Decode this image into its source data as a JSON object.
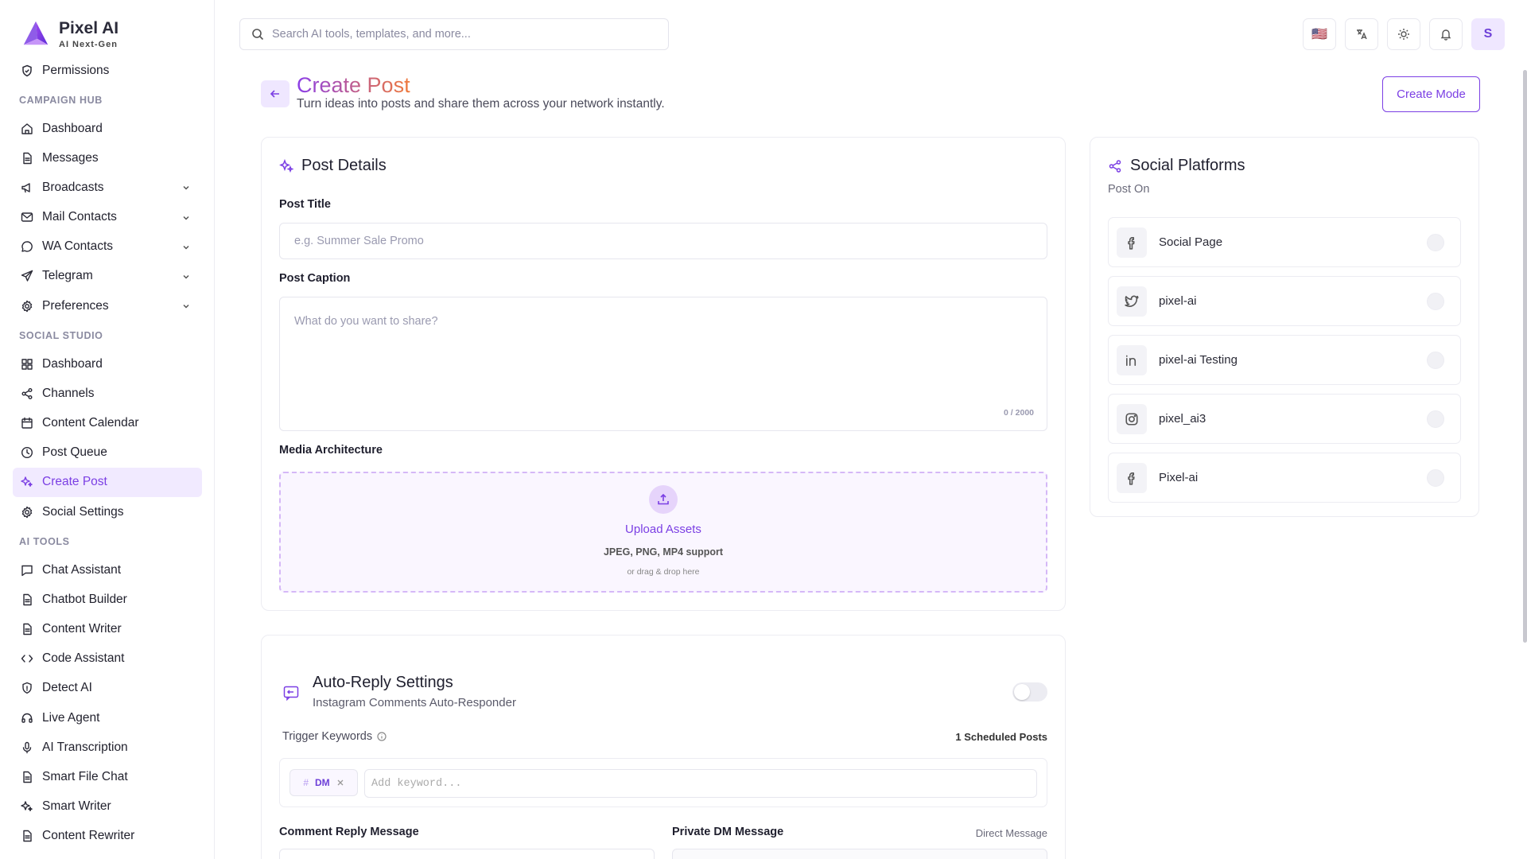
{
  "brand": {
    "name": "Pixel AI",
    "tagline": "AI Next-Gen"
  },
  "sidebar": {
    "top_item": "Permissions",
    "sections": [
      {
        "title": "CAMPAIGN HUB",
        "items": [
          {
            "label": "Dashboard",
            "icon": "home-icon"
          },
          {
            "label": "Messages",
            "icon": "document-icon"
          },
          {
            "label": "Broadcasts",
            "icon": "megaphone-icon",
            "expandable": true
          },
          {
            "label": "Mail Contacts",
            "icon": "mail-icon",
            "expandable": true
          },
          {
            "label": "WA Contacts",
            "icon": "chat-bubble-icon",
            "expandable": true
          },
          {
            "label": "Telegram",
            "icon": "send-icon",
            "expandable": true
          },
          {
            "label": "Preferences",
            "icon": "gear-icon",
            "expandable": true
          }
        ]
      },
      {
        "title": "SOCIAL STUDIO",
        "items": [
          {
            "label": "Dashboard",
            "icon": "grid-icon"
          },
          {
            "label": "Channels",
            "icon": "share-icon"
          },
          {
            "label": "Content Calendar",
            "icon": "calendar-icon"
          },
          {
            "label": "Post Queue",
            "icon": "clock-icon"
          },
          {
            "label": "Create Post",
            "icon": "sparkle-icon",
            "active": true
          },
          {
            "label": "Social Settings",
            "icon": "gear-icon"
          }
        ]
      },
      {
        "title": "AI TOOLS",
        "items": [
          {
            "label": "Chat Assistant",
            "icon": "chat-icon"
          },
          {
            "label": "Chatbot Builder",
            "icon": "document-icon"
          },
          {
            "label": "Content Writer",
            "icon": "document-icon"
          },
          {
            "label": "Code Assistant",
            "icon": "code-icon"
          },
          {
            "label": "Detect AI",
            "icon": "shield-icon"
          },
          {
            "label": "Live Agent",
            "icon": "headset-icon"
          },
          {
            "label": "AI Transcription",
            "icon": "mic-icon"
          },
          {
            "label": "Smart File Chat",
            "icon": "document-icon"
          },
          {
            "label": "Smart Writer",
            "icon": "sparkle-icon"
          },
          {
            "label": "Content Rewriter",
            "icon": "document-icon"
          }
        ]
      }
    ]
  },
  "topbar": {
    "search_placeholder": "Search AI tools, templates, and more...",
    "avatar_initial": "S",
    "flag": "🇺🇸"
  },
  "header": {
    "title": "Create Post",
    "subtitle": "Turn ideas into posts and share them across your network instantly.",
    "create_mode_label": "Create Mode"
  },
  "post_details": {
    "title": "Post Details",
    "post_title_label": "Post Title",
    "post_title_placeholder": "e.g. Summer Sale Promo",
    "caption_label": "Post Caption",
    "caption_placeholder": "What do you want to share?",
    "caption_counter": "0 / 2000",
    "media_label": "Media Architecture",
    "upload_title": "Upload Assets",
    "upload_types": "JPEG, PNG, MP4 support",
    "upload_drag": "or drag & drop here"
  },
  "social_platforms": {
    "title": "Social Platforms",
    "subtitle": "Post On",
    "items": [
      {
        "name": "Social Page",
        "icon": "facebook-icon"
      },
      {
        "name": "pixel-ai",
        "icon": "twitter-icon"
      },
      {
        "name": "pixel-ai Testing",
        "icon": "linkedin-icon"
      },
      {
        "name": "pixel_ai3",
        "icon": "instagram-icon"
      },
      {
        "name": "Pixel-ai",
        "icon": "facebook-icon"
      }
    ]
  },
  "auto_reply": {
    "title": "Auto-Reply Settings",
    "subtitle": "Instagram Comments Auto-Responder",
    "enabled": false,
    "trigger_label": "Trigger Keywords",
    "scheduled_count": "1 Scheduled Posts",
    "keyword_chip": "DM",
    "keyword_placeholder": "Add keyword...",
    "comment_reply_label": "Comment Reply Message",
    "private_dm_label": "Private DM Message",
    "direct_message_label": "Direct Message"
  },
  "colors": {
    "accent": "#7b3fe4",
    "accent_soft": "#efe7ff"
  }
}
